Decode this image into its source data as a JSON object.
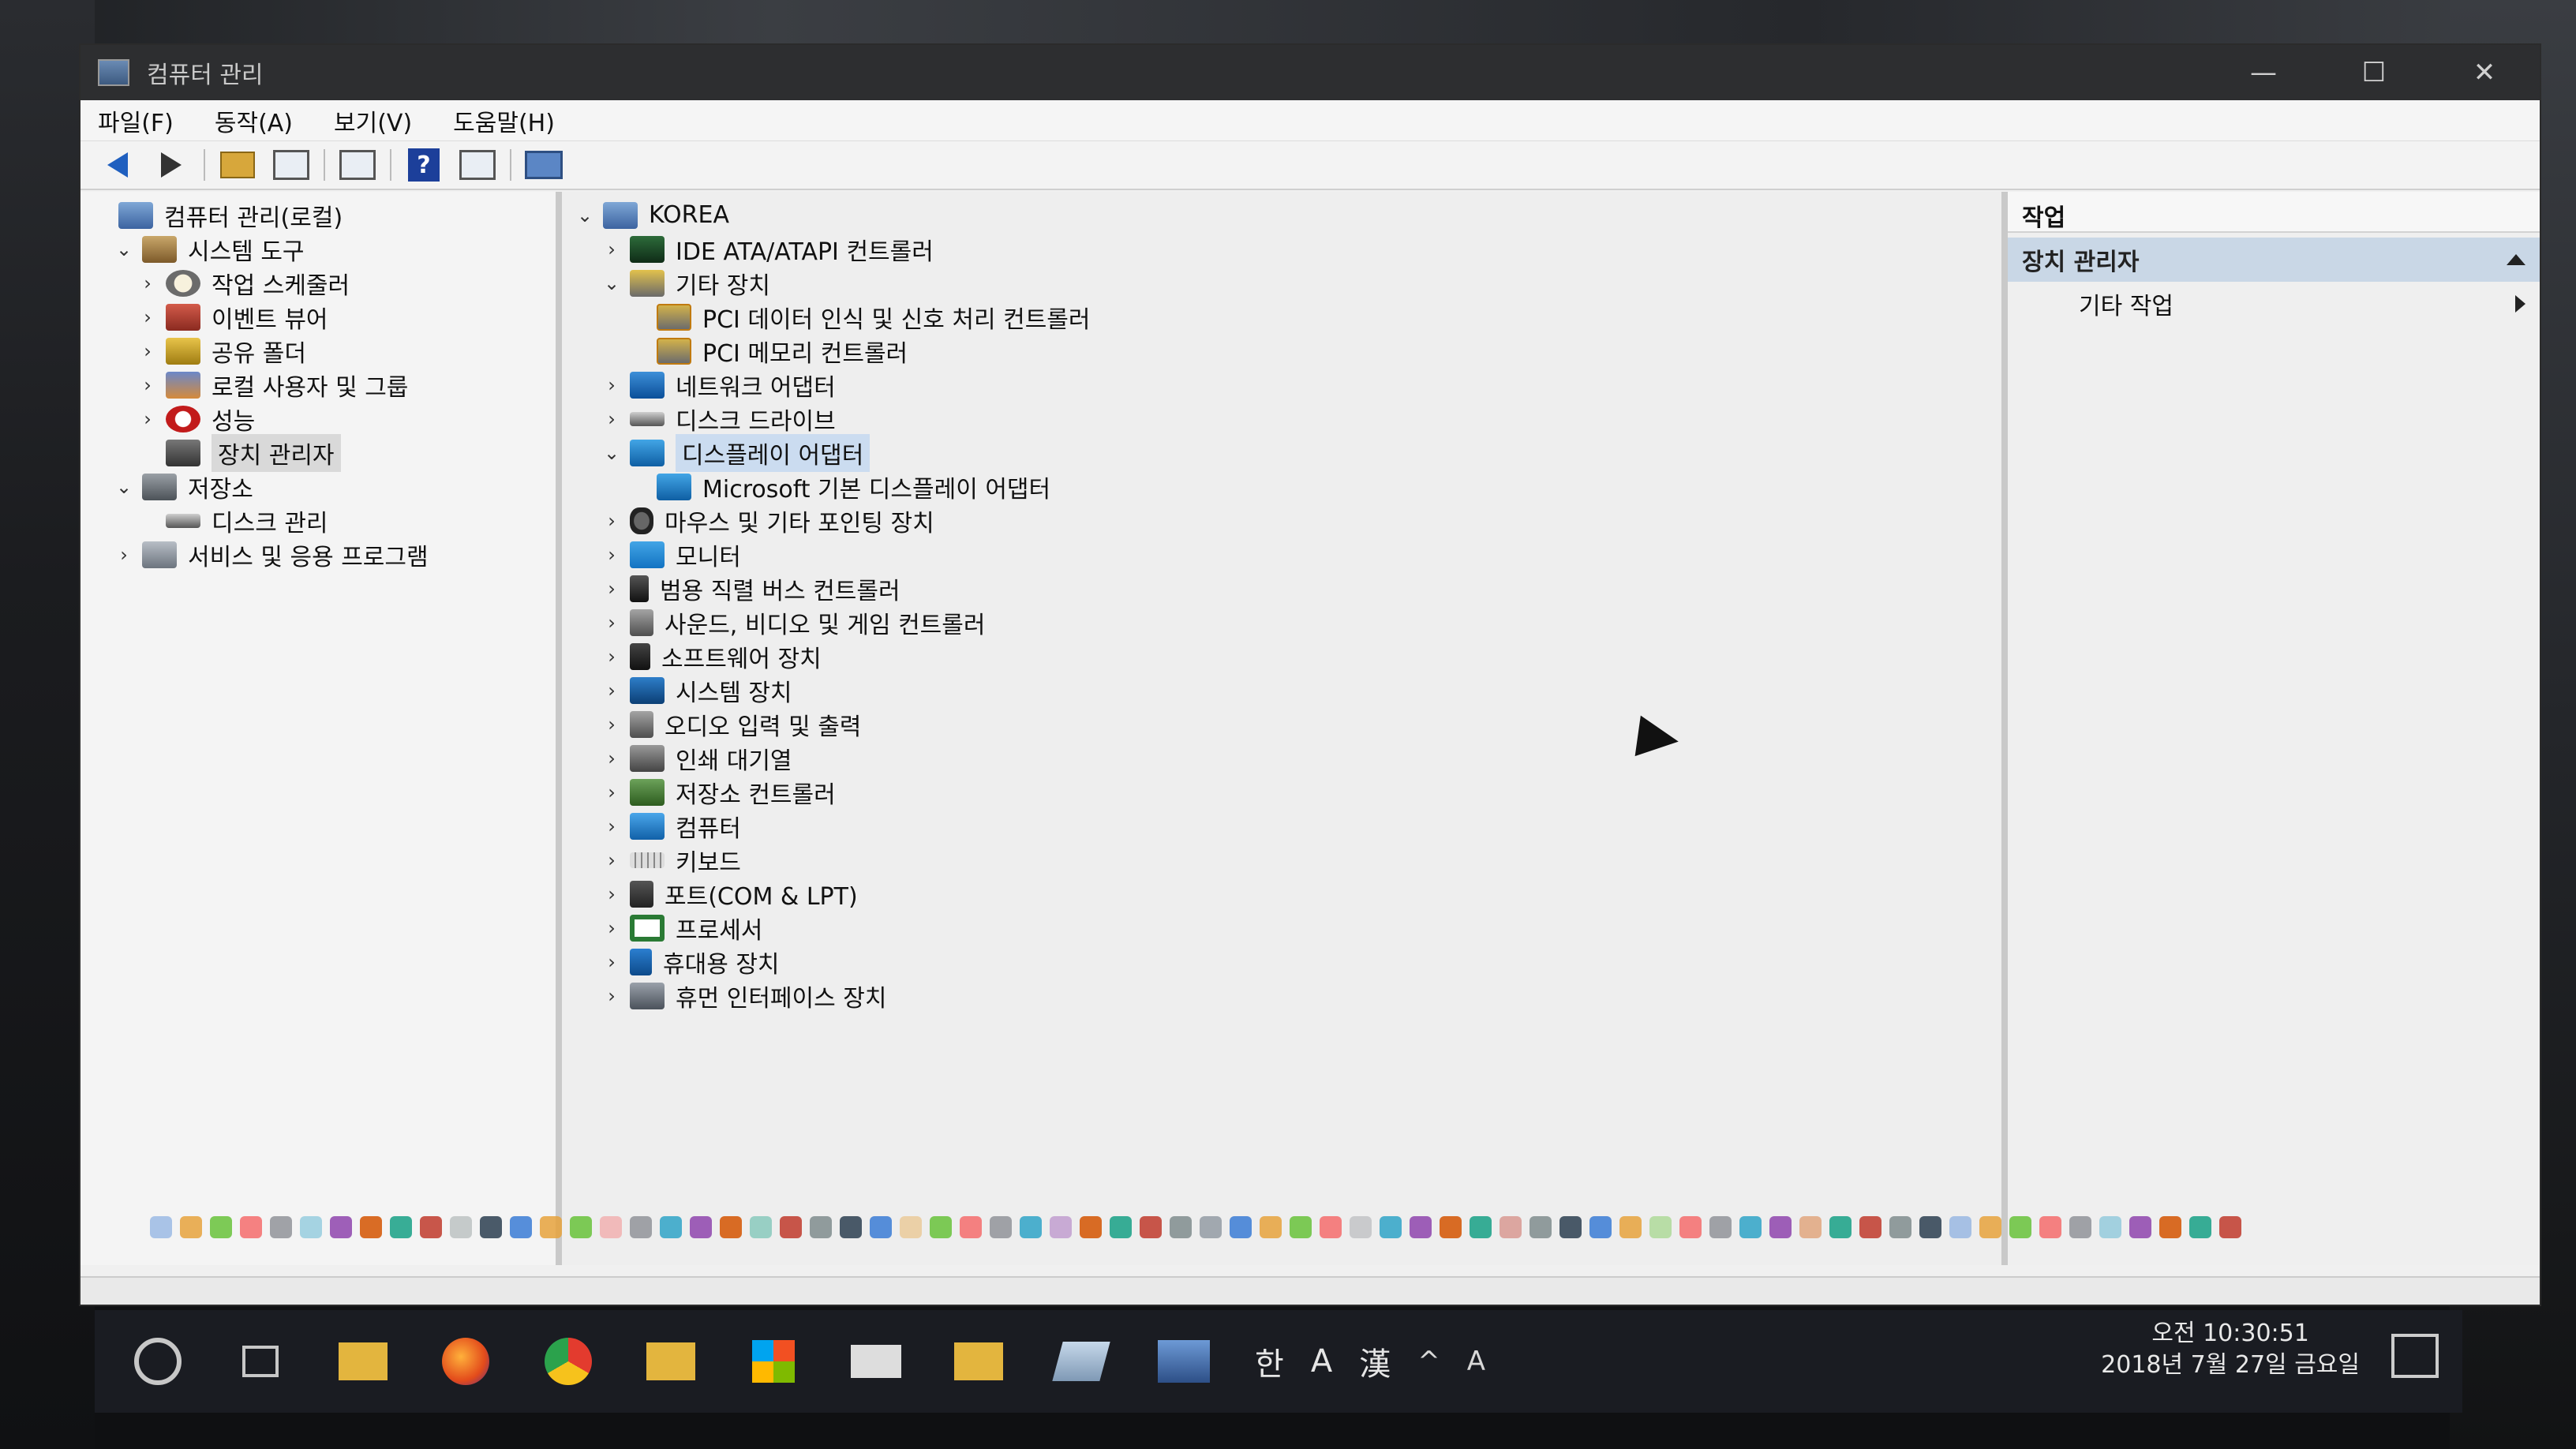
{
  "window": {
    "title": "컴퓨터 관리",
    "controls": [
      "—",
      "☐",
      "✕"
    ]
  },
  "menu": [
    "파일(F)",
    "동작(A)",
    "보기(V)",
    "도움말(H)"
  ],
  "left_tree": [
    {
      "label": "컴퓨터 관리(로컬)",
      "chev": "",
      "icon": "i-comp",
      "indent": 0
    },
    {
      "label": "시스템 도구",
      "chev": "⌄",
      "icon": "i-tools",
      "indent": 1
    },
    {
      "label": "작업 스케줄러",
      "chev": "›",
      "icon": "i-clock",
      "indent": 2
    },
    {
      "label": "이벤트 뷰어",
      "chev": "›",
      "icon": "i-event",
      "indent": 2
    },
    {
      "label": "공유 폴더",
      "chev": "›",
      "icon": "i-share",
      "indent": 2
    },
    {
      "label": "로컬 사용자 및 그룹",
      "chev": "›",
      "icon": "i-users",
      "indent": 2
    },
    {
      "label": "성능",
      "chev": "›",
      "icon": "i-perf",
      "indent": 2
    },
    {
      "label": "장치 관리자",
      "chev": "",
      "icon": "i-devmgr",
      "indent": 2,
      "selected": true
    },
    {
      "label": "저장소",
      "chev": "⌄",
      "icon": "i-storage",
      "indent": 1
    },
    {
      "label": "디스크 관리",
      "chev": "",
      "icon": "i-disk",
      "indent": 2
    },
    {
      "label": "서비스 및 응용 프로그램",
      "chev": "›",
      "icon": "i-service",
      "indent": 1
    }
  ],
  "device_tree": [
    {
      "label": "KOREA",
      "chev": "⌄",
      "icon": "i-comp",
      "indent": 0
    },
    {
      "label": "IDE ATA/ATAPI 컨트롤러",
      "chev": "›",
      "icon": "i-ide",
      "indent": 1
    },
    {
      "label": "기타 장치",
      "chev": "⌄",
      "icon": "i-other",
      "indent": 1
    },
    {
      "label": "PCI 데이터 인식 및 신호 처리 컨트롤러",
      "chev": "",
      "icon": "i-warn",
      "indent": 2
    },
    {
      "label": "PCI 메모리 컨트롤러",
      "chev": "",
      "icon": "i-warn",
      "indent": 2
    },
    {
      "label": "네트워크 어댑터",
      "chev": "›",
      "icon": "i-net",
      "indent": 1
    },
    {
      "label": "디스크 드라이브",
      "chev": "›",
      "icon": "i-disk",
      "indent": 1
    },
    {
      "label": "디스플레이 어댑터",
      "chev": "⌄",
      "icon": "i-display",
      "indent": 1,
      "selected": true
    },
    {
      "label": "Microsoft 기본 디스플레이 어댑터",
      "chev": "",
      "icon": "i-display",
      "indent": 2
    },
    {
      "label": "마우스 및 기타 포인팅 장치",
      "chev": "›",
      "icon": "i-mouse",
      "indent": 1
    },
    {
      "label": "모니터",
      "chev": "›",
      "icon": "i-monitor",
      "indent": 1
    },
    {
      "label": "범용 직렬 버스 컨트롤러",
      "chev": "›",
      "icon": "i-usb",
      "indent": 1
    },
    {
      "label": "사운드, 비디오 및 게임 컨트롤러",
      "chev": "›",
      "icon": "i-sound",
      "indent": 1
    },
    {
      "label": "소프트웨어 장치",
      "chev": "›",
      "icon": "i-soft",
      "indent": 1
    },
    {
      "label": "시스템 장치",
      "chev": "›",
      "icon": "i-sys",
      "indent": 1
    },
    {
      "label": "오디오 입력 및 출력",
      "chev": "›",
      "icon": "i-sound",
      "indent": 1
    },
    {
      "label": "인쇄 대기열",
      "chev": "›",
      "icon": "i-print",
      "indent": 1
    },
    {
      "label": "저장소 컨트롤러",
      "chev": "›",
      "icon": "i-stor-ctrl",
      "indent": 1
    },
    {
      "label": "컴퓨터",
      "chev": "›",
      "icon": "i-pc",
      "indent": 1
    },
    {
      "label": "키보드",
      "chev": "›",
      "icon": "i-kbd",
      "indent": 1
    },
    {
      "label": "포트(COM & LPT)",
      "chev": "›",
      "icon": "i-port",
      "indent": 1
    },
    {
      "label": "프로세서",
      "chev": "›",
      "icon": "i-cpu",
      "indent": 1
    },
    {
      "label": "휴대용 장치",
      "chev": "›",
      "icon": "i-portable",
      "indent": 1
    },
    {
      "label": "휴먼 인터페이스 장치",
      "chev": "›",
      "icon": "i-hid",
      "indent": 1
    }
  ],
  "actions": {
    "header": "작업",
    "section": "장치 관리자",
    "sub": "기타 작업"
  },
  "taskbar": {
    "ime": [
      "한",
      "A",
      "漢"
    ],
    "tray_text": [
      "^",
      "A"
    ],
    "time": "오전 10:30:51",
    "date": "2018년 7월 27일 금요일"
  },
  "colors": {
    "accent": "#1f5fbf",
    "selection": "#cbdcf0",
    "taskbar": "#1a1c22"
  }
}
